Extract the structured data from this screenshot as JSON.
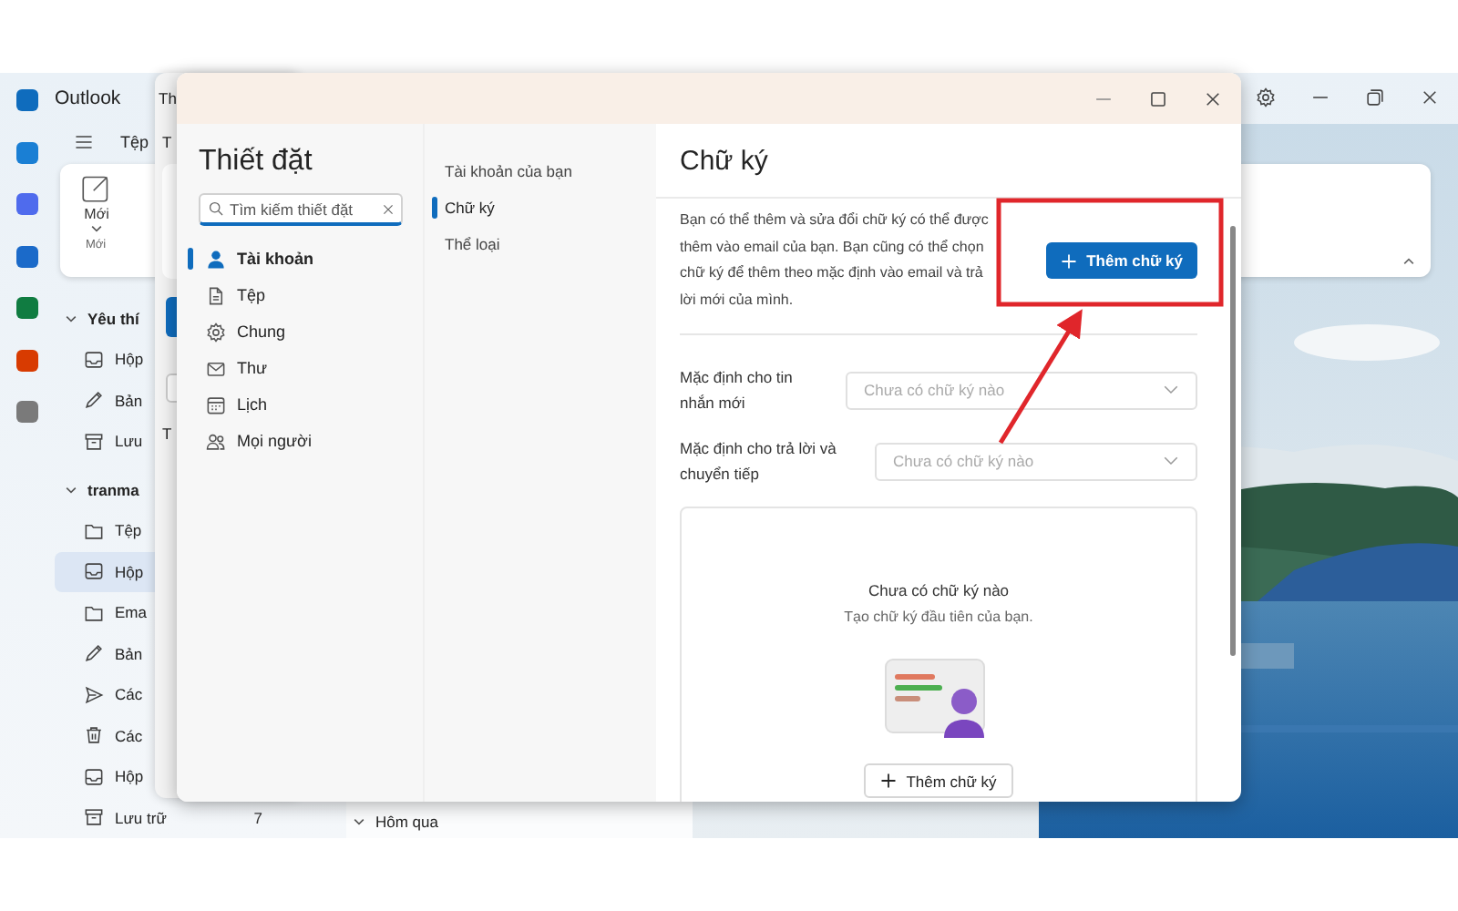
{
  "outlook": {
    "app_name": "Outlook",
    "apps": [
      {
        "color": "#0f6cbd"
      },
      {
        "color": "#1a7fd4"
      },
      {
        "color": "#4f6bed"
      },
      {
        "color": "#1b6ac9"
      },
      {
        "color": "#107c41"
      },
      {
        "color": "#d83b01"
      },
      {
        "color": "#7a7a7a"
      }
    ],
    "menu_tab": "Tệp",
    "new_button": {
      "label": "Mới",
      "group": "Mới"
    },
    "sections": [
      {
        "heading": "Yêu thí",
        "expanded": true,
        "items": [
          {
            "label": "Hộp",
            "kind": "inbox",
            "selected": false
          },
          {
            "label": "Bản",
            "kind": "pencil",
            "selected": false
          },
          {
            "label": "Lưu",
            "kind": "archive",
            "selected": false
          }
        ]
      },
      {
        "heading": "tranma",
        "expanded": true,
        "items": [
          {
            "label": "Tệp",
            "kind": "folder",
            "selected": false
          },
          {
            "label": "Hộp",
            "kind": "inbox",
            "selected": true
          },
          {
            "label": "Ema",
            "kind": "folder",
            "selected": false
          },
          {
            "label": "Bản",
            "kind": "pencil",
            "selected": false
          },
          {
            "label": "Các",
            "kind": "send",
            "selected": false
          },
          {
            "label": "Các",
            "kind": "trash",
            "selected": false
          },
          {
            "label": "Hộp",
            "kind": "inbox",
            "selected": false
          },
          {
            "label": "Lưu trữ",
            "kind": "archive",
            "selected": false,
            "count": "7"
          }
        ]
      }
    ],
    "list_group": "Hôm qua"
  },
  "behind_window": {
    "title": "Th",
    "tab": "T",
    "label": "T"
  },
  "dialog": {
    "title": "Thiết đặt",
    "search": {
      "placeholder": "Tìm kiếm thiết đặt"
    },
    "categories": [
      {
        "label": "Tài khoản",
        "kind": "person",
        "selected": true
      },
      {
        "label": "Tệp",
        "kind": "file",
        "selected": false
      },
      {
        "label": "Chung",
        "kind": "gear",
        "selected": false
      },
      {
        "label": "Thư",
        "kind": "mail",
        "selected": false
      },
      {
        "label": "Lịch",
        "kind": "calendar",
        "selected": false
      },
      {
        "label": "Mọi người",
        "kind": "people",
        "selected": false
      }
    ],
    "subcategories": [
      {
        "label": "Tài khoản của bạn",
        "selected": false
      },
      {
        "label": "Chữ ký",
        "selected": true
      },
      {
        "label": "Thể loại",
        "selected": false
      }
    ],
    "panel": {
      "title": "Chữ ký",
      "description": "Bạn có thể thêm và sửa đổi chữ ký có thể được thêm vào email của bạn. Bạn cũng có thể chọn chữ ký để thêm theo mặc định vào email và trả lời mới của mình.",
      "add_button": "Thêm chữ ký",
      "defaults": [
        {
          "label": "Mặc định cho tin nhắn mới",
          "placeholder": "Chưa có chữ ký nào"
        },
        {
          "label": "Mặc định cho trả lời và chuyển tiếp",
          "placeholder": "Chưa có chữ ký nào"
        }
      ],
      "empty_title": "Chưa có chữ ký nào",
      "empty_text": "Tạo chữ ký đầu tiên của bạn.",
      "empty_button": "Thêm chữ ký"
    }
  }
}
